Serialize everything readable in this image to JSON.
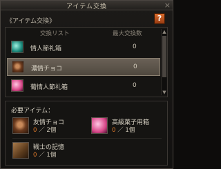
{
  "window": {
    "title": "アイテム交換",
    "close_icon": "×"
  },
  "subtitle": "《アイテム交換》",
  "help_label": "?",
  "list": {
    "headers": {
      "left": "交換リスト",
      "right": "最大交換数"
    },
    "items": [
      {
        "name": "情人節礼箱",
        "max": "0",
        "icon": "teal-giftbox-icon"
      },
      {
        "name": "濃情チョコ",
        "max": "0",
        "icon": "chocolate-icon"
      },
      {
        "name": "葡情人節礼箱",
        "max": "0",
        "icon": "pink-giftbox-icon"
      }
    ],
    "selected_index": 1
  },
  "required": {
    "label": "必要アイテム：",
    "items": [
      {
        "name": "友情チョコ",
        "have": "0",
        "need": "／ 2個",
        "icon": "chocolate-icon"
      },
      {
        "name": "高級菓子用箱",
        "have": "0",
        "need": "／ 1個",
        "icon": "pink-box-icon"
      },
      {
        "name": "戦士の記憶",
        "have": "0",
        "need": "／ 1個",
        "icon": "scroll-icon"
      }
    ]
  },
  "colors": {
    "have_count": "#e07a2a",
    "help_button": "#d86a2a"
  }
}
